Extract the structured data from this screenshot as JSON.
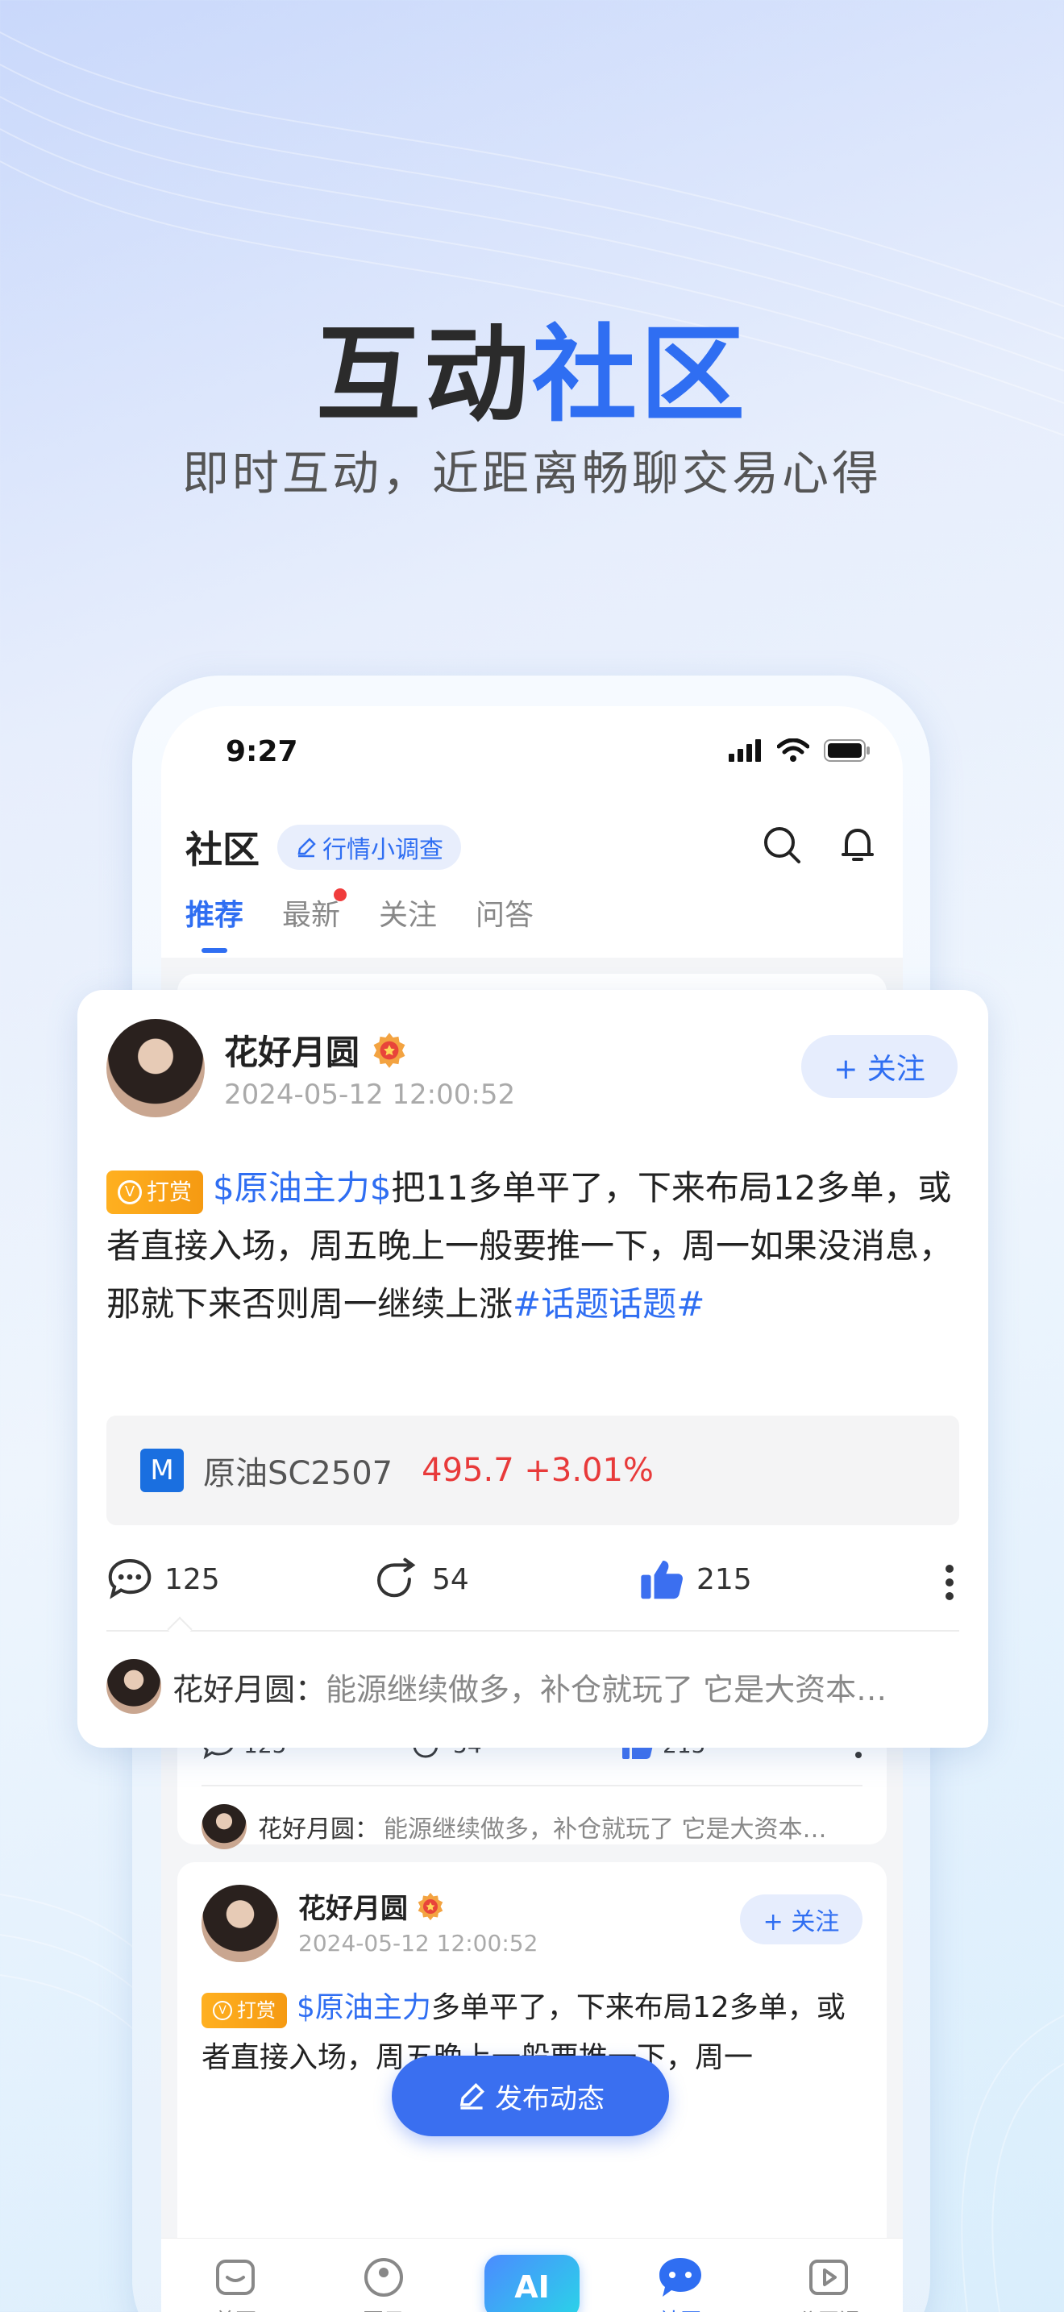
{
  "hero": {
    "title_main": "互动",
    "title_accent": "社区",
    "subtitle": "即时互动，近距离畅聊交易心得"
  },
  "status_bar": {
    "time": "9:27"
  },
  "header": {
    "title": "社区",
    "survey_chip": "行情小调查"
  },
  "tabs": [
    {
      "label": "推荐",
      "active": true
    },
    {
      "label": "最新",
      "active": false,
      "dot": true
    },
    {
      "label": "关注",
      "active": false
    },
    {
      "label": "问答",
      "active": false
    }
  ],
  "main_post": {
    "author": "花好月圆",
    "time": "2024-05-12 12:00:52",
    "follow_label": "+ 关注",
    "tip_badge": "打赏",
    "topic_tag": "$原油主力$",
    "body": "把11多单平了，下来布局12多单，或者直接入场，周五晚上一般要推一下，周一如果没消息，那就下来否则周一继续上涨",
    "hashtag": "#话题话题#",
    "quote": {
      "icon_letter": "M",
      "name": "原油SC2507",
      "price": "495.7 +3.01%"
    },
    "comments": "125",
    "reposts": "54",
    "likes": "215",
    "top_comment": {
      "author": "花好月圆：",
      "text": "能源继续做多，补仓就玩了 它是大资本…"
    }
  },
  "feed_item_1": {
    "comments": "125",
    "reposts": "54",
    "likes": "215",
    "top_comment": {
      "author": "花好月圆：",
      "text": "能源继续做多，补仓就玩了 它是大资本…"
    }
  },
  "feed_item_2": {
    "author": "花好月圆",
    "time": "2024-05-12 12:00:52",
    "follow_label": "+ 关注",
    "tip_badge": "打赏",
    "topic_tag": "$原油主力",
    "body_tail": "多单平了，下来布局12多单，或者直接入场，周五晚上一般要推一下，周一"
  },
  "publish_button": "发布动态",
  "bottom_nav": [
    {
      "label": "首页"
    },
    {
      "label": "圈子"
    },
    {
      "label": "AI"
    },
    {
      "label": "社区",
      "active": true
    },
    {
      "label": "公开课"
    }
  ],
  "colors": {
    "accent": "#2f6ef2",
    "price_up": "#e83a3a",
    "tip": "#f59a12"
  }
}
